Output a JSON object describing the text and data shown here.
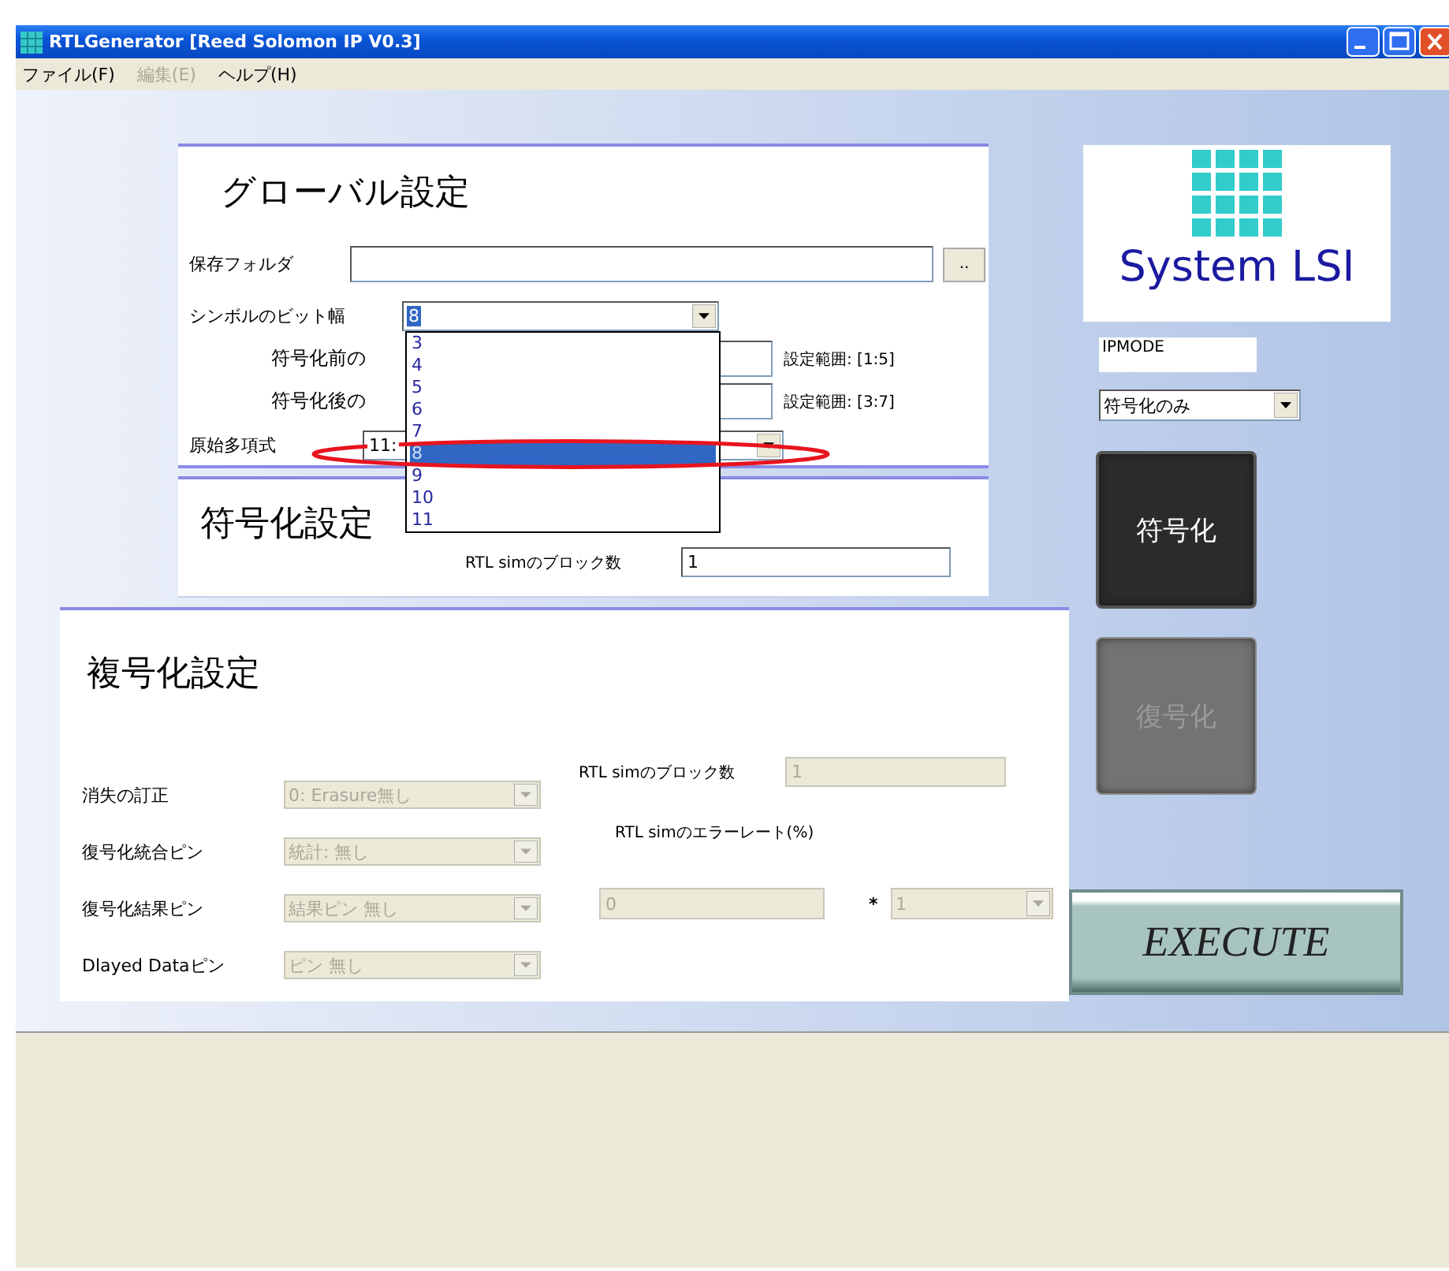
{
  "window": {
    "title": "RTLGenerator [Reed Solomon IP V0.3]"
  },
  "menu": [
    {
      "label": "ファイル(F)",
      "disabled": false
    },
    {
      "label": "編集(E)",
      "disabled": true
    },
    {
      "label": "ヘルプ(H)",
      "disabled": false
    }
  ],
  "global_settings": {
    "title": "グローバル設定",
    "save_folder": {
      "label": "保存フォルダ",
      "browse_button": ".."
    },
    "symbol_bits": {
      "label": "シンボルのビット幅",
      "value": "8",
      "expanded": true,
      "options": [
        {
          "label": "3",
          "selected": false,
          "circled": false
        },
        {
          "label": "4",
          "selected": false,
          "circled": false
        },
        {
          "label": "5",
          "selected": false,
          "circled": false
        },
        {
          "label": "6",
          "selected": false,
          "circled": false
        },
        {
          "label": "7",
          "selected": false,
          "circled": false
        },
        {
          "label": "8",
          "selected": true,
          "circled": true
        },
        {
          "label": "9",
          "selected": false,
          "circled": false
        },
        {
          "label": "10",
          "selected": false,
          "circled": false
        },
        {
          "label": "11",
          "selected": false,
          "circled": false
        }
      ]
    },
    "pre_encode": {
      "label": "符号化前の",
      "range": "設定範囲: [1:5]"
    },
    "post_encode": {
      "label": "符号化後の",
      "range": "設定範囲: [3:7]"
    },
    "primitive_polynomial": {
      "label": "原始多項式",
      "value": "11:"
    }
  },
  "encode_settings": {
    "title": "符号化設定",
    "rtl_blocks": {
      "label": "RTL simのブロック数",
      "value": "1"
    }
  },
  "decode_settings": {
    "title": "複号化設定",
    "fields": [
      {
        "label": "消失の訂正",
        "value": "0: Erasure無し",
        "disabled": true
      },
      {
        "label": "復号化統合ピン",
        "value": "統計: 無し",
        "disabled": true
      },
      {
        "label": "復号化結果ピン",
        "value": "結果ピン 無し",
        "disabled": true
      },
      {
        "label": "Dlayed Dataピン",
        "value": "ピン 無し",
        "disabled": true
      }
    ],
    "rtl_blocks": {
      "label": "RTL simのブロック数",
      "value": "1",
      "disabled": true
    },
    "error_rate": {
      "label": "RTL simのエラーレート(%)",
      "mantissa": "0",
      "separator": "*",
      "exponent": "1",
      "disabled": true
    }
  },
  "side": {
    "logo": "System LSI",
    "ipmode": {
      "label": "IPMODE"
    },
    "mode": {
      "value": "符号化のみ"
    },
    "encode_button": {
      "label": "符号化",
      "disabled": false
    },
    "decode_button": {
      "label": "復号化",
      "disabled": true
    },
    "execute_button": {
      "label": "EXECUTE"
    }
  }
}
